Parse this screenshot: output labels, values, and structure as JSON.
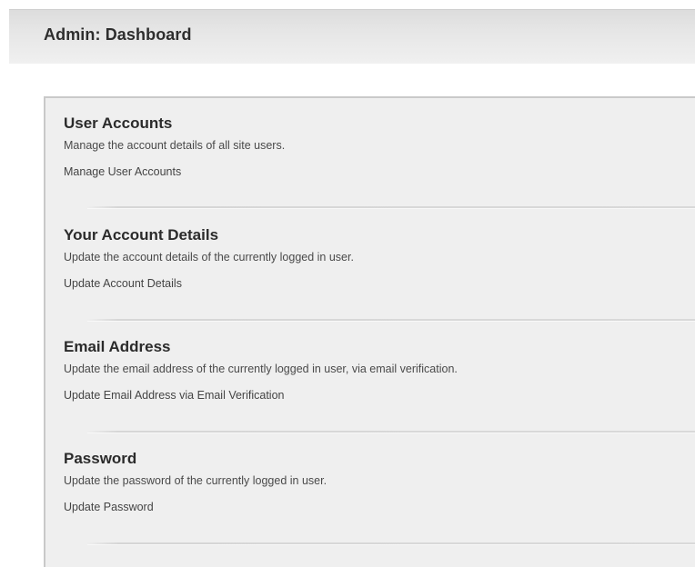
{
  "header": {
    "title": "Admin: Dashboard"
  },
  "sections": [
    {
      "title": "User Accounts",
      "description": "Manage the account details of all site users.",
      "link": "Manage User Accounts"
    },
    {
      "title": "Your Account Details",
      "description": "Update the account details of the currently logged in user.",
      "link": "Update Account Details"
    },
    {
      "title": "Email Address",
      "description": "Update the email address of the currently logged in user, via email verification.",
      "link": "Update Email Address via Email Verification"
    },
    {
      "title": "Password",
      "description": "Update the password of the currently logged in user.",
      "link": "Update Password"
    }
  ]
}
